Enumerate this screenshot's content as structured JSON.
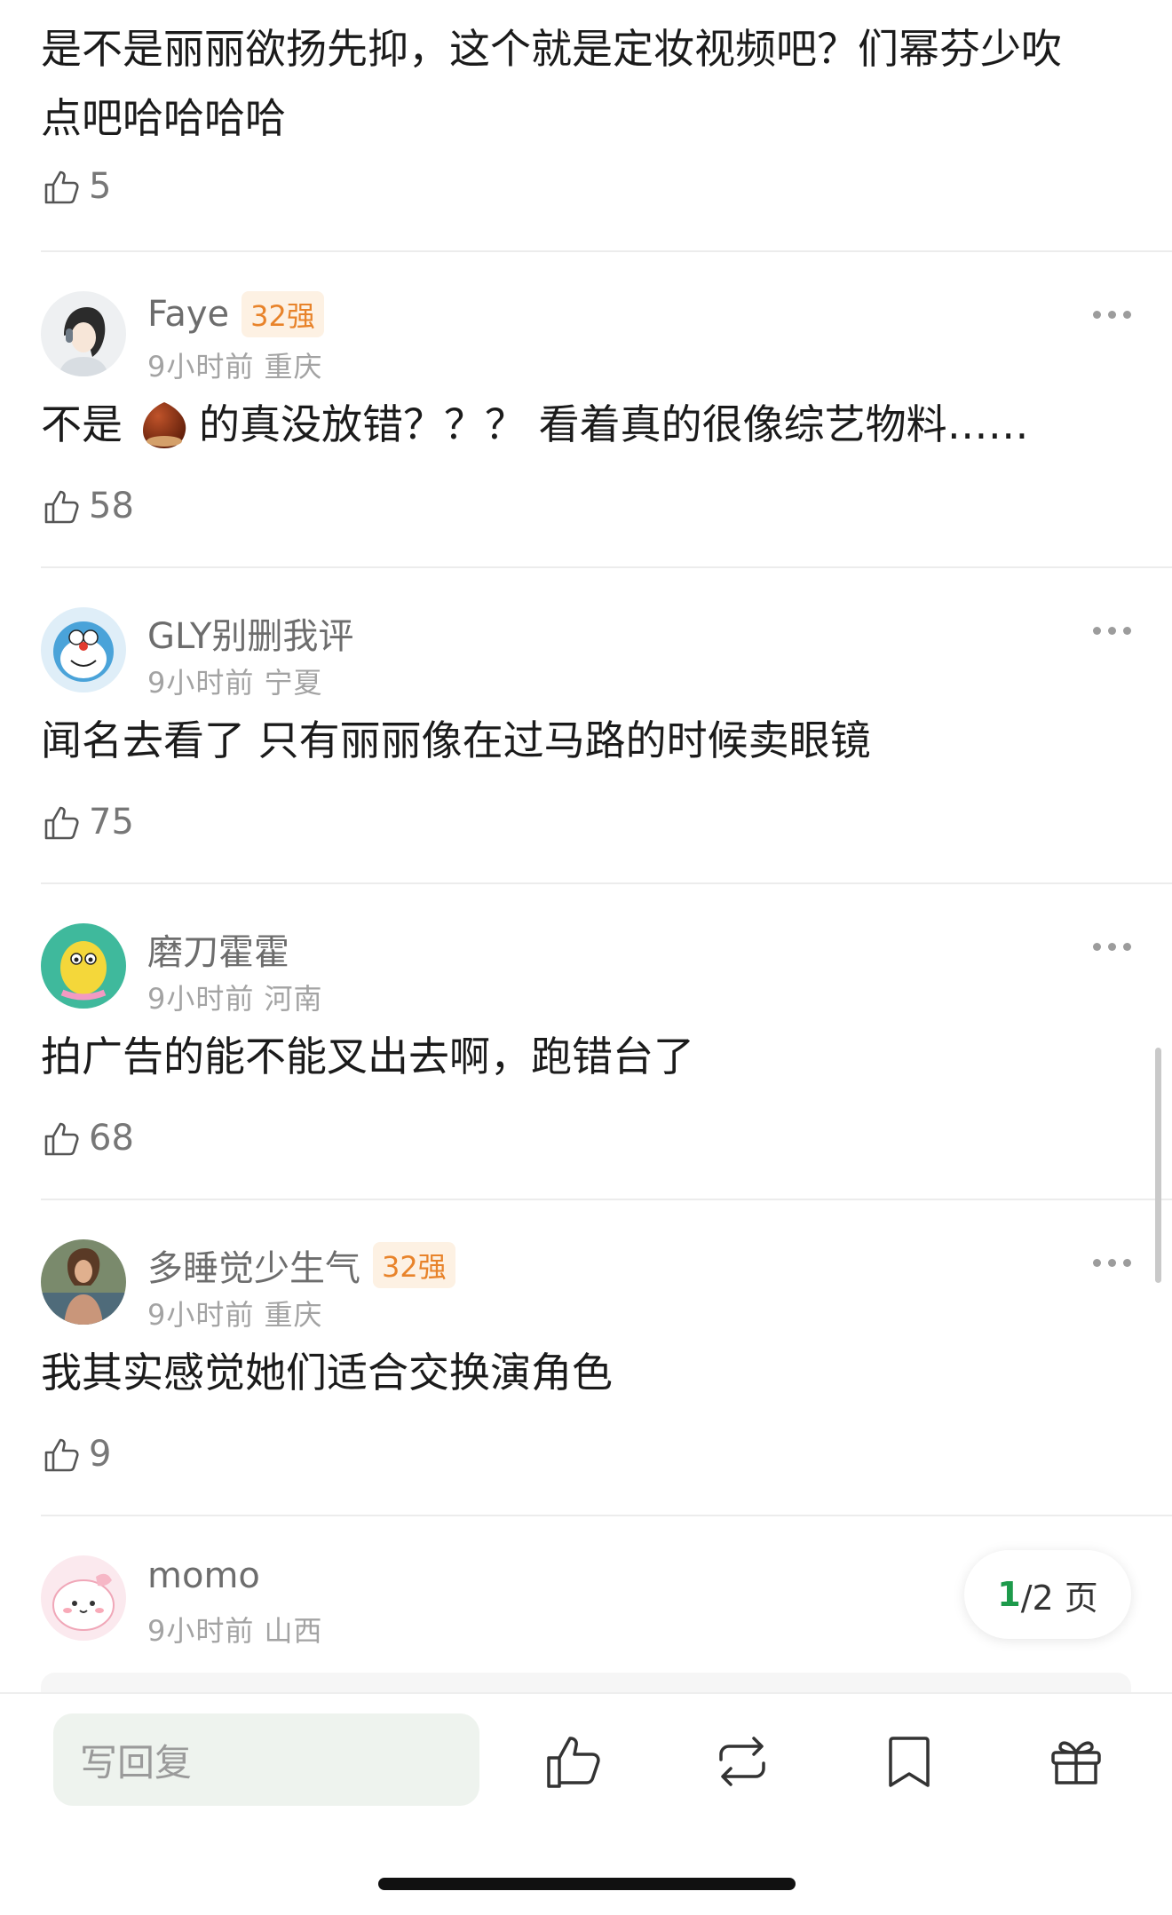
{
  "top_comment": {
    "text_line1": "是不是丽丽欲扬先抑，这个就是定妆视频吧？们幂芬少吹",
    "text_line2": "点吧哈哈哈哈",
    "likes": "5"
  },
  "comments": [
    {
      "name": "Faye",
      "badge": "32强",
      "time": "9小时前",
      "location": "重庆",
      "text_before": "不是",
      "text_after": "的真没放错？？？ 看着真的很像综艺物料……",
      "likes": "58",
      "avatar": "avatar-girl-headphones"
    },
    {
      "name": "GLY别删我评",
      "time": "9小时前",
      "location": "宁夏",
      "text": "闻名去看了 只有丽丽像在过马路的时候卖眼镜",
      "likes": "75",
      "avatar": "avatar-doraemon"
    },
    {
      "name": "磨刀霍霍",
      "time": "9小时前",
      "location": "河南",
      "text": "拍广告的能不能叉出去啊，跑错台了",
      "likes": "68",
      "avatar": "avatar-cartoon-yellow"
    },
    {
      "name": "多睡觉少生气",
      "badge": "32强",
      "time": "9小时前",
      "location": "重庆",
      "text": "我其实感觉她们适合交换演角色",
      "likes": "9",
      "avatar": "avatar-photo-woman"
    },
    {
      "name": "momo",
      "time": "9小时前",
      "location": "山西",
      "avatar": "avatar-pink-bunny"
    }
  ],
  "pagination": {
    "current": "1",
    "rest": "/2 页"
  },
  "bottom_bar": {
    "reply_placeholder": "写回复",
    "icons": [
      "like-icon",
      "repost-icon",
      "bookmark-icon",
      "gift-icon"
    ]
  },
  "colors": {
    "badge": "#e8832a",
    "page_current": "#1d9a4b",
    "meta": "#a3a3a3"
  }
}
